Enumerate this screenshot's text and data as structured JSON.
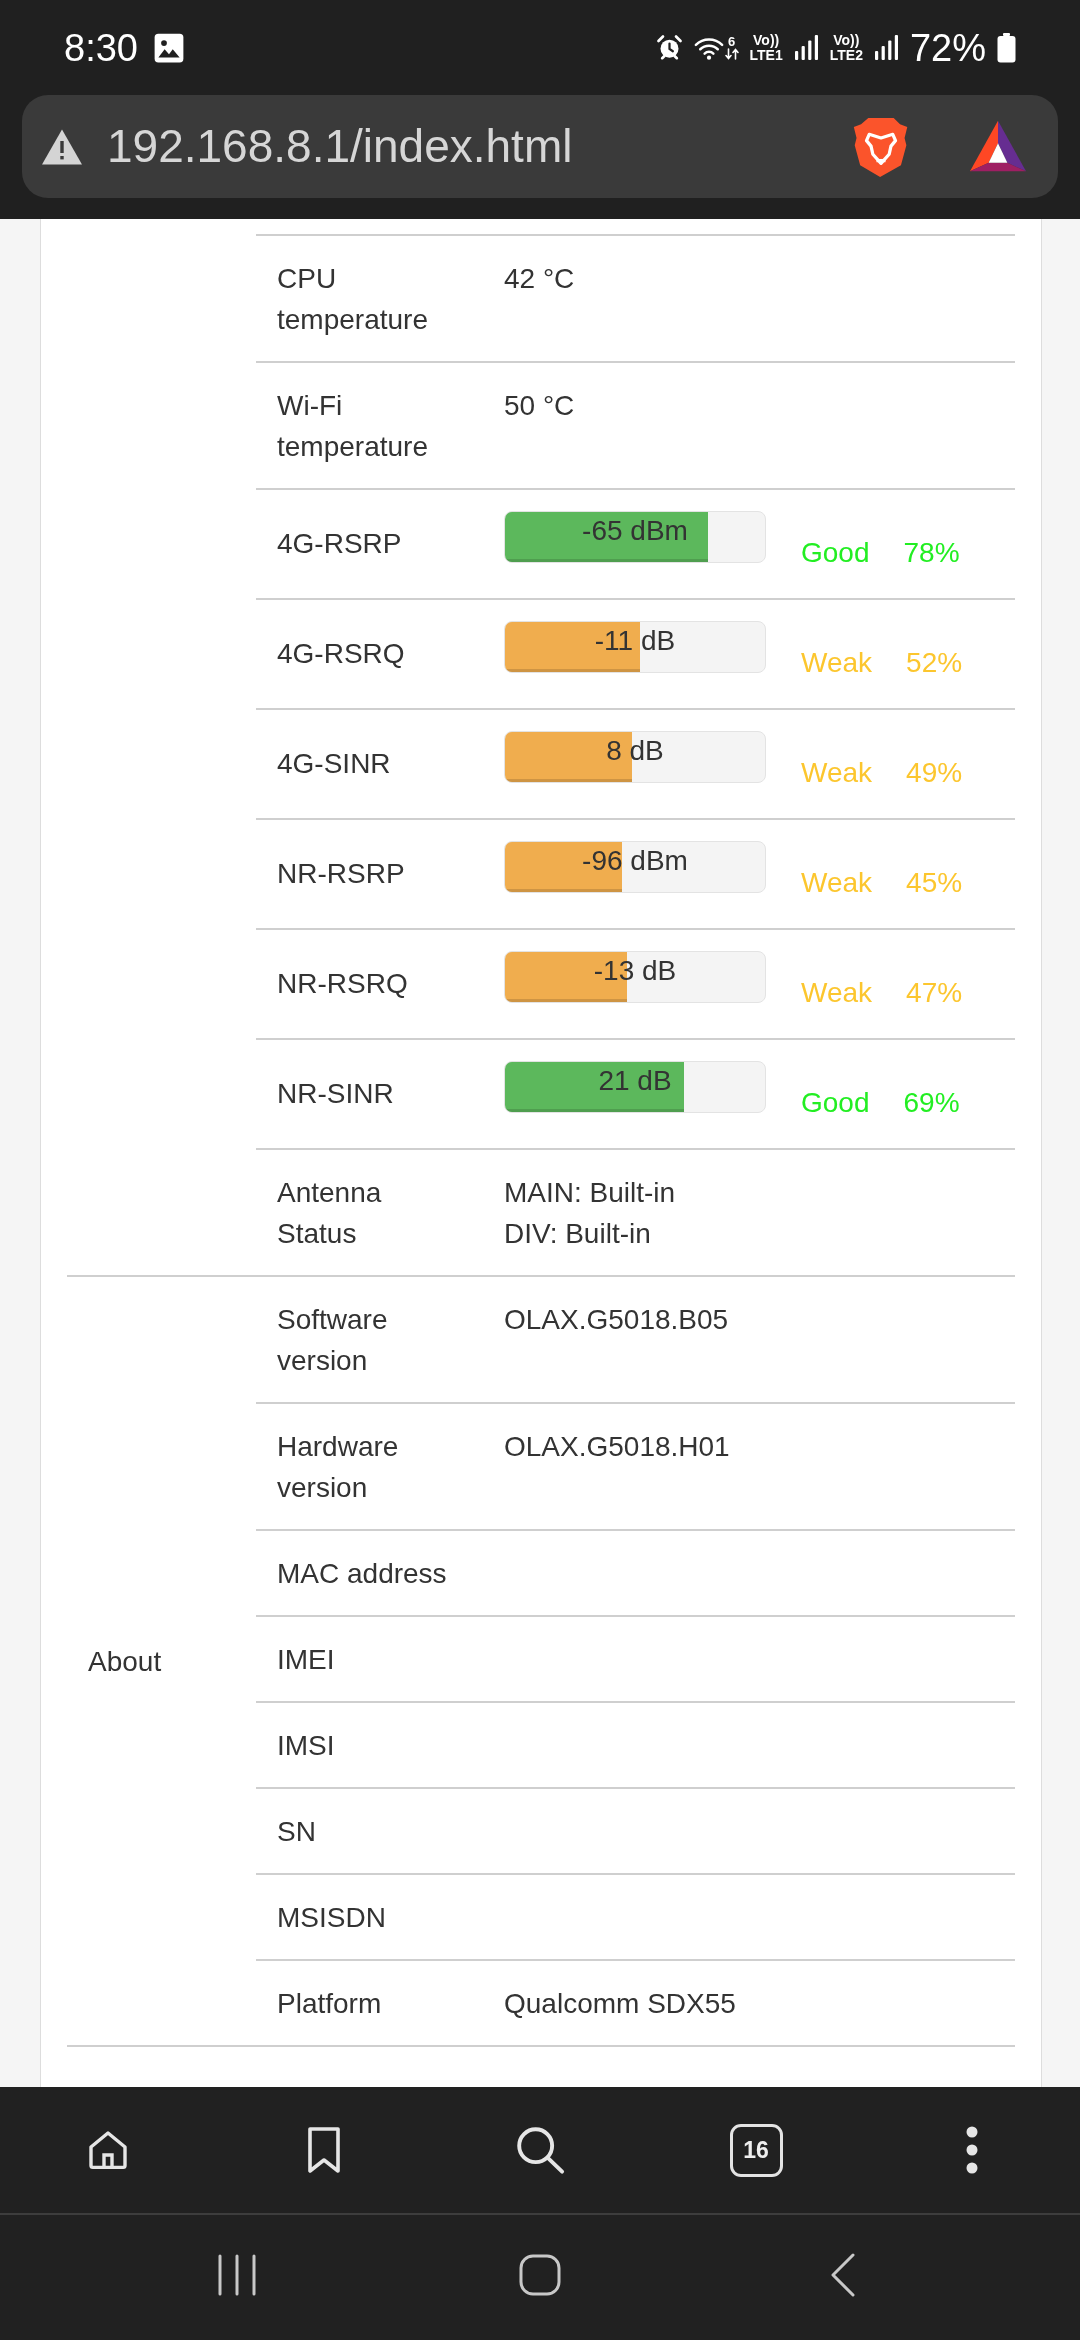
{
  "status_bar": {
    "time": "8:30",
    "wifi_badge": "6",
    "sims": [
      {
        "top": "Vo))",
        "bottom": "LTE1"
      },
      {
        "top": "Vo))",
        "bottom": "LTE2"
      }
    ],
    "battery": "72%"
  },
  "address_bar": {
    "url": "192.168.8.1/index.html"
  },
  "sections": [
    {
      "rows": [
        {
          "kind": "text",
          "label": "CPU temperature",
          "values": [
            "42 °C"
          ]
        },
        {
          "kind": "text",
          "label": "Wi-Fi temperature",
          "values": [
            "50 °C"
          ]
        },
        {
          "kind": "meter",
          "label": "4G-RSRP",
          "reading": "-65 dBm",
          "level": 0.78,
          "good": true,
          "rating": "Good",
          "percent": "78%"
        },
        {
          "kind": "meter",
          "label": "4G-RSRQ",
          "reading": "-11 dB",
          "level": 0.52,
          "good": false,
          "rating": "Weak",
          "percent": "52%"
        },
        {
          "kind": "meter",
          "label": "4G-SINR",
          "reading": "8 dB",
          "level": 0.49,
          "good": false,
          "rating": "Weak",
          "percent": "49%"
        },
        {
          "kind": "meter",
          "label": "NR-RSRP",
          "reading": "-96 dBm",
          "level": 0.45,
          "good": false,
          "rating": "Weak",
          "percent": "45%"
        },
        {
          "kind": "meter",
          "label": "NR-RSRQ",
          "reading": "-13 dB",
          "level": 0.47,
          "good": false,
          "rating": "Weak",
          "percent": "47%"
        },
        {
          "kind": "meter",
          "label": "NR-SINR",
          "reading": "21 dB",
          "level": 0.69,
          "good": true,
          "rating": "Good",
          "percent": "69%"
        },
        {
          "kind": "text",
          "label": "Antenna Status",
          "values": [
            "MAIN: Built-in",
            "DIV: Built-in"
          ]
        }
      ]
    },
    {
      "title": "About",
      "rows": [
        {
          "kind": "text",
          "label": "Software version",
          "values": [
            "OLAX.G5018.B05"
          ]
        },
        {
          "kind": "text",
          "label": "Hardware version",
          "values": [
            "OLAX.G5018.H01"
          ]
        },
        {
          "kind": "text",
          "label": "MAC address"
        },
        {
          "kind": "text",
          "label": "IMEI"
        },
        {
          "kind": "text",
          "label": "IMSI"
        },
        {
          "kind": "text",
          "label": "SN"
        },
        {
          "kind": "text",
          "label": "MSISDN"
        },
        {
          "kind": "text",
          "label": "Platform",
          "values": [
            "Qualcomm SDX55"
          ]
        }
      ]
    }
  ],
  "toolbar": {
    "tab_count": "16"
  }
}
